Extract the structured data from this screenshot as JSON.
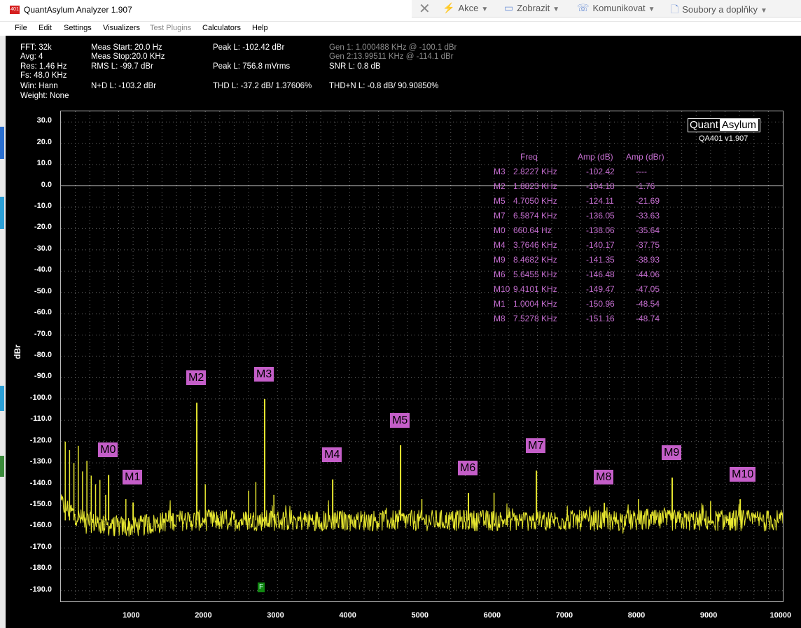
{
  "window": {
    "icon_text": "401",
    "title": "QuantAsylum Analyzer 1.907"
  },
  "toolbar": {
    "items": [
      {
        "label": "Akce"
      },
      {
        "label": "Zobrazit"
      },
      {
        "label": "Komunikovat"
      },
      {
        "label": "Soubory a doplňky"
      }
    ]
  },
  "menu": [
    "File",
    "Edit",
    "Settings",
    "Visualizers",
    "Test Plugins",
    "Calculators",
    "Help"
  ],
  "info": {
    "fft": "FFT: 32k",
    "avg": "Avg: 4",
    "res": "Res: 1.46 Hz",
    "fs": "Fs: 48.0 KHz",
    "win": "Win: Hann",
    "weight": "Weight: None",
    "meas_start": "Meas Start: 20.0 Hz",
    "meas_stop": "Meas Stop:20.0 KHz",
    "rms": "RMS L: -99.7 dBr",
    "nd": "N+D L: -103.2 dBr",
    "peak_dbr": "Peak L: -102.42 dBr",
    "peak_mv": "Peak L: 756.8 mVrms",
    "thd": "THD L: -37.2 dB/ 1.37606%",
    "gen1": "Gen 1: 1.000488 KHz @ -100.1  dBr",
    "gen2": "Gen 2:13.99511 KHz @ -114.1  dBr",
    "snr": "SNR L: 0.8 dB",
    "thdn": "THD+N L: -0.8 dB/ 90.90850%"
  },
  "brand": {
    "left": "Quant",
    "right": "Asylum",
    "version": "QA401 v1.907"
  },
  "marker_table": {
    "headers": [
      "Freq",
      "Amp (dB)",
      "Amp (dBr)"
    ],
    "rows": [
      {
        "m": "M3",
        "freq": "2.8227 KHz",
        "amp": "-102.42",
        "ampr": "----"
      },
      {
        "m": "M2",
        "freq": "1.8823 KHz",
        "amp": "-104.18",
        "ampr": "-1.76"
      },
      {
        "m": "M5",
        "freq": "4.7050 KHz",
        "amp": "-124.11",
        "ampr": "-21.69"
      },
      {
        "m": "M7",
        "freq": "6.5874 KHz",
        "amp": "-136.05",
        "ampr": "-33.63"
      },
      {
        "m": "M0",
        "freq": "660.64 Hz",
        "amp": "-138.06",
        "ampr": "-35.64"
      },
      {
        "m": "M4",
        "freq": "3.7646 KHz",
        "amp": "-140.17",
        "ampr": "-37.75"
      },
      {
        "m": "M9",
        "freq": "8.4682 KHz",
        "amp": "-141.35",
        "ampr": "-38.93"
      },
      {
        "m": "M6",
        "freq": "5.6455 KHz",
        "amp": "-146.48",
        "ampr": "-44.06"
      },
      {
        "m": "M10",
        "freq": "9.4101 KHz",
        "amp": "-149.47",
        "ampr": "-47.05"
      },
      {
        "m": "M1",
        "freq": "1.0004 KHz",
        "amp": "-150.96",
        "ampr": "-48.54"
      },
      {
        "m": "M8",
        "freq": "7.5278 KHz",
        "amp": "-151.16",
        "ampr": "-48.74"
      }
    ]
  },
  "f_marker": "F",
  "chart_data": {
    "type": "line",
    "ylabel": "dBr",
    "xlim": [
      0,
      10000
    ],
    "ylim": [
      -195,
      35
    ],
    "yticks": [
      30,
      20,
      10,
      0,
      -10,
      -20,
      -30,
      -40,
      -50,
      -60,
      -70,
      -80,
      -90,
      -100,
      -110,
      -120,
      -130,
      -140,
      -150,
      -160,
      -170,
      -180,
      -190
    ],
    "xticks": [
      1000,
      2000,
      3000,
      4000,
      5000,
      6000,
      7000,
      8000,
      9000,
      10000
    ],
    "reference_line_dbr": 0,
    "grid": true,
    "colors": {
      "trace": "#e8e830",
      "reference": "#dddddd",
      "marker": "#c45ec8",
      "grid": "#666666"
    },
    "markers": [
      {
        "name": "M0",
        "freq_hz": 660.64,
        "dbr": -135.64
      },
      {
        "name": "M1",
        "freq_hz": 1000.4,
        "dbr": -148.54
      },
      {
        "name": "M2",
        "freq_hz": 1882.3,
        "dbr": -101.76
      },
      {
        "name": "M3",
        "freq_hz": 2822.7,
        "dbr": -100
      },
      {
        "name": "M4",
        "freq_hz": 3764.6,
        "dbr": -137.75
      },
      {
        "name": "M5",
        "freq_hz": 4705.0,
        "dbr": -121.69
      },
      {
        "name": "M6",
        "freq_hz": 5645.5,
        "dbr": -144.06
      },
      {
        "name": "M7",
        "freq_hz": 6587.4,
        "dbr": -133.63
      },
      {
        "name": "M8",
        "freq_hz": 7527.8,
        "dbr": -148.74
      },
      {
        "name": "M9",
        "freq_hz": 8468.2,
        "dbr": -136.93
      },
      {
        "name": "M10",
        "freq_hz": 9410.1,
        "dbr": -147.05
      }
    ],
    "spurs": [
      {
        "freq_hz": 60,
        "dbr": -120
      },
      {
        "freq_hz": 120,
        "dbr": -124
      },
      {
        "freq_hz": 180,
        "dbr": -130
      },
      {
        "freq_hz": 240,
        "dbr": -122
      },
      {
        "freq_hz": 300,
        "dbr": -134
      },
      {
        "freq_hz": 360,
        "dbr": -129
      },
      {
        "freq_hz": 420,
        "dbr": -136
      },
      {
        "freq_hz": 480,
        "dbr": -140
      },
      {
        "freq_hz": 540,
        "dbr": -138
      },
      {
        "freq_hz": 620,
        "dbr": -145
      },
      {
        "freq_hz": 900,
        "dbr": -147
      },
      {
        "freq_hz": 2000,
        "dbr": -140
      },
      {
        "freq_hz": 2600,
        "dbr": -143
      },
      {
        "freq_hz": 2700,
        "dbr": -139
      },
      {
        "freq_hz": 2950,
        "dbr": -145
      },
      {
        "freq_hz": 5000,
        "dbr": -147
      },
      {
        "freq_hz": 6000,
        "dbr": -144
      },
      {
        "freq_hz": 8000,
        "dbr": -147
      },
      {
        "freq_hz": 9000,
        "dbr": -148
      }
    ],
    "noise_floor_dbr": -157
  }
}
